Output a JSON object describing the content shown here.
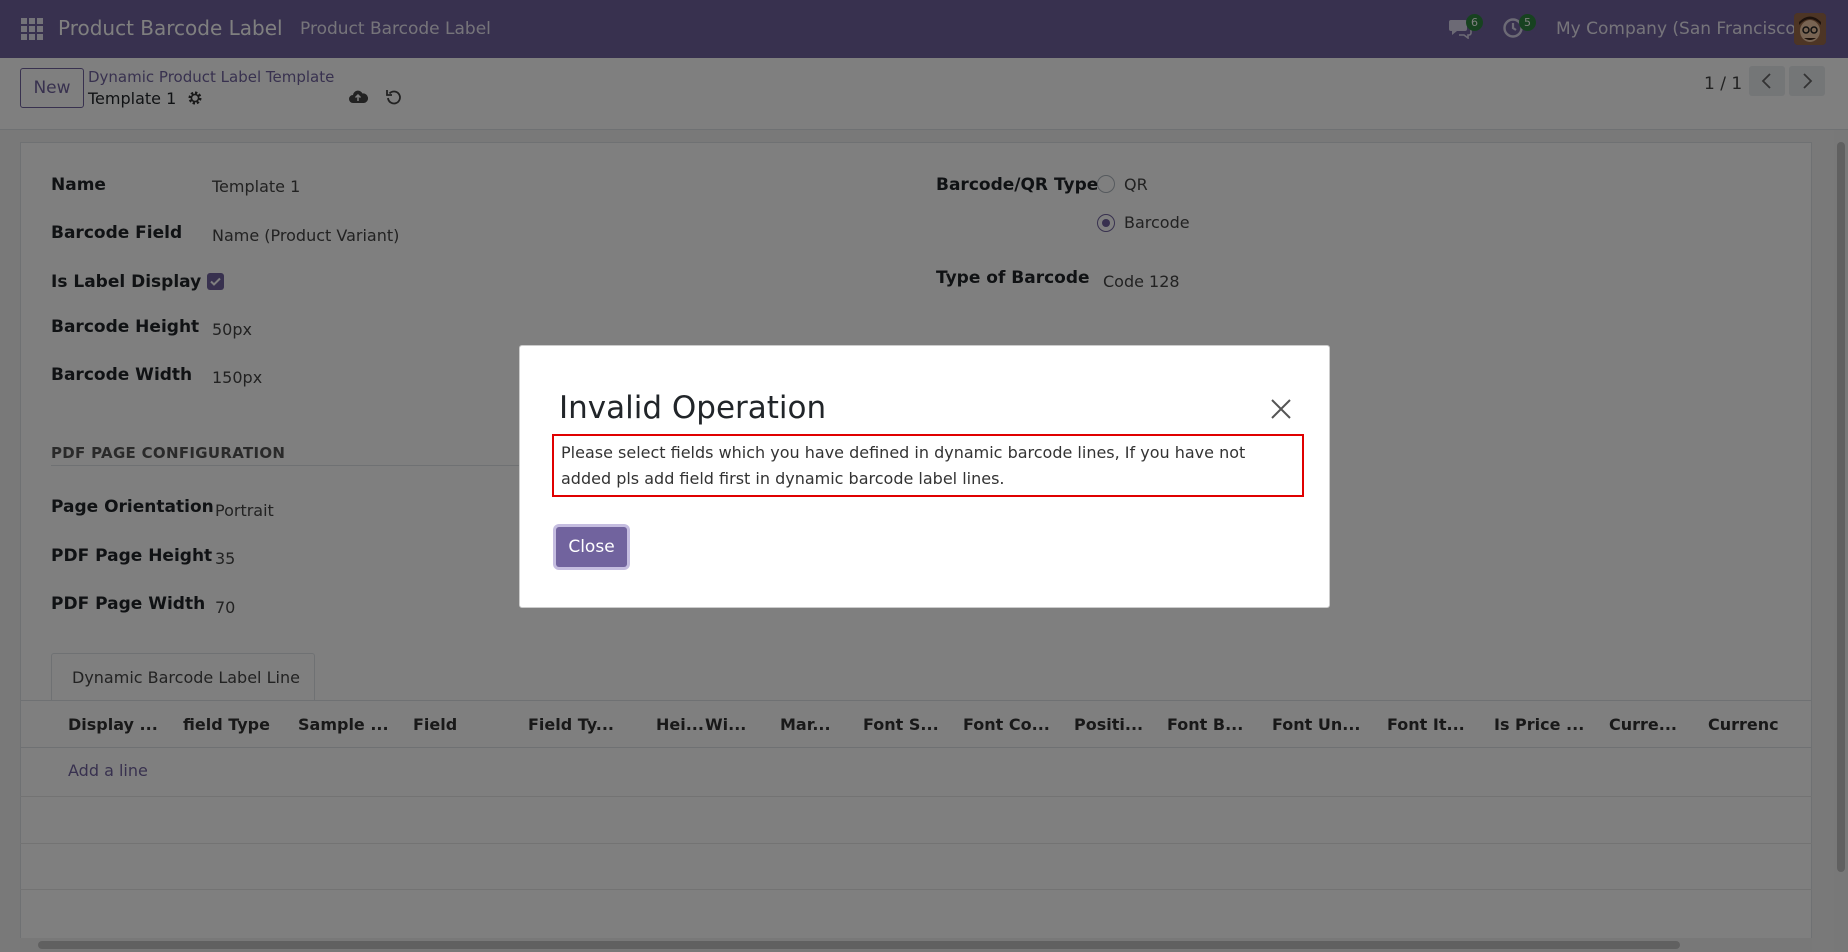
{
  "navbar": {
    "brand": "Product Barcode Label",
    "menu_item": "Product Barcode Label",
    "messages_count": "6",
    "activities_count": "5",
    "company": "My Company (San Francisco)"
  },
  "control": {
    "new_label": "New",
    "breadcrumb_parent": "Dynamic Product Label Template",
    "breadcrumb_current": "Template 1",
    "pager": "1 / 1"
  },
  "form": {
    "name_label": "Name",
    "name_value": "Template 1",
    "barcode_field_label": "Barcode Field",
    "barcode_field_value": "Name (Product Variant)",
    "label_display_label": "Is Label Display ?",
    "label_display_checked": true,
    "barcode_height_label": "Barcode Height",
    "barcode_height_value": "50px",
    "barcode_width_label": "Barcode Width",
    "barcode_width_value": "150px",
    "qr_type_label": "Barcode/QR Type",
    "qr_option": "QR",
    "barcode_option": "Barcode",
    "selected_type": "Barcode",
    "type_of_barcode_label": "Type of Barcode",
    "type_of_barcode_value": "Code 128",
    "pdf_section_title": "PDF PAGE CONFIGURATION",
    "page_orientation_label": "Page Orientation",
    "page_orientation_value": "Portrait",
    "pdf_height_label": "PDF Page Height",
    "pdf_height_value": "35",
    "pdf_width_label": "PDF Page Width",
    "pdf_width_value": "70"
  },
  "lines": {
    "tab_label": "Dynamic Barcode Label Line",
    "columns": [
      "Display ...",
      "field Type",
      "Sample ...",
      "Field",
      "Field Ty...",
      "Hei...",
      "Wi...",
      "Mar...",
      "Font S...",
      "Font Co...",
      "Positi...",
      "Font B...",
      "Font Un...",
      "Font It...",
      "Is Price ...",
      "Curre...",
      "Currenc"
    ],
    "add_line": "Add a line"
  },
  "dialog": {
    "title": "Invalid Operation",
    "message": "Please select fields which you have defined in dynamic barcode lines, If you have not added pls add field first in dynamic barcode label lines.",
    "close_label": "Close"
  },
  "colors": {
    "brand": "#71639e",
    "badge": "#2e8540",
    "highlight_border": "#e00000"
  }
}
